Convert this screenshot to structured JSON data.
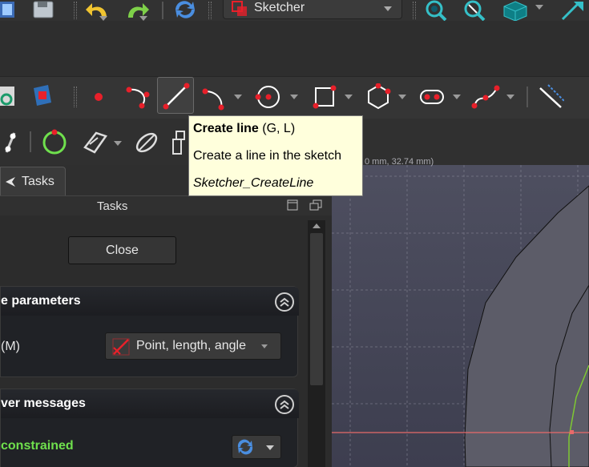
{
  "top_toolbar": {
    "workbench_selector": {
      "value": "Sketcher"
    }
  },
  "tasks_tab": {
    "label": "Tasks"
  },
  "task_panel": {
    "title": "Tasks",
    "close_button": "Close",
    "parameters_box": {
      "title": "e parameters",
      "mode_label": "(M)",
      "mode_value": "Point, length, angle"
    },
    "messages_box": {
      "title": "ver messages",
      "status": "constrained"
    }
  },
  "tooltip": {
    "title": "Create line",
    "shortcut": " (G, L)",
    "description": "Create a line in the sketch",
    "command": "Sketcher_CreateLine"
  },
  "viewport": {
    "coords_fragment": "0 mm, 32.74 mm)"
  },
  "colors": {
    "sketch_red": "#e8202a",
    "constraint_green": "#6fe04d",
    "axis_line": "#e86a6a",
    "tooltip_bg": "#ffffdc"
  }
}
